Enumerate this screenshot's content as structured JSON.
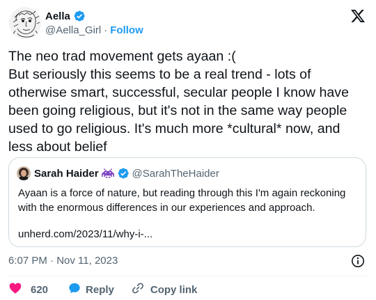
{
  "author": {
    "name": "Aella",
    "handle": "@Aella_Girl",
    "separator": "·",
    "follow_label": "Follow",
    "avatar_icon": "sketched-face-avatar",
    "verified_icon": "verified-badge-icon"
  },
  "tweet": {
    "text": "The neo trad movement gets ayaan :(\nBut seriously this seems to be a real trend - lots of otherwise smart, successful, secular people I know have been going religious, but it's not in the same way people used to go religious. It's much more *cultural* now, and less about belief"
  },
  "quote": {
    "name": "Sarah Haider",
    "handle": "@SarahTheHaider",
    "emoji_icon": "space-invader-emoji",
    "text": "Ayaan is a force of nature, but reading  through this I'm again reckoning with the enormous differences in our experiences and approach.",
    "link": "unherd.com/2023/11/why-i-..."
  },
  "timestamp": "6:07 PM · Nov 11, 2023",
  "actions": {
    "like_count": "620",
    "reply_label": "Reply",
    "copy_label": "Copy link"
  },
  "colors": {
    "accent": "#1d9bf0",
    "like": "#f91880",
    "secondary_text": "#536471",
    "border": "#cfd9de"
  }
}
